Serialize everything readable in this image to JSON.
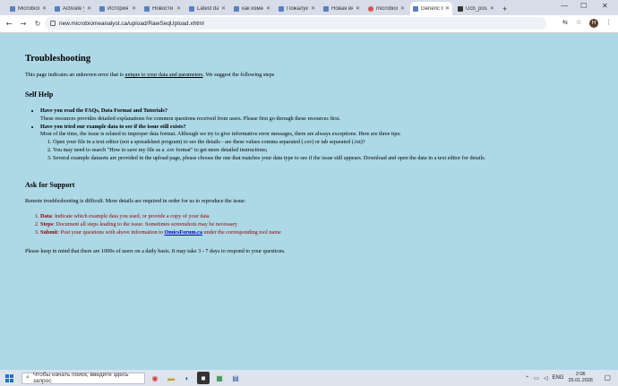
{
  "browser": {
    "tabs": [
      {
        "label": "Microbiom"
      },
      {
        "label": "Activate y"
      },
      {
        "label": "История"
      },
      {
        "label": "Новости"
      },
      {
        "label": "Latest data"
      },
      {
        "label": "как измени"
      },
      {
        "label": "Пожалуйс"
      },
      {
        "label": "Новая вкл"
      },
      {
        "label": "microbiom"
      },
      {
        "label": "Generic Er"
      },
      {
        "label": "Ucb_possib"
      }
    ],
    "new_tab": "+",
    "url": "new.microbiomeanalyst.ca/upload/RawSeqUpload.xhtml",
    "avatar_letter": "Н"
  },
  "page": {
    "title": "Troubleshooting",
    "intro_pre": "This page indicates an unknown error that is ",
    "intro_link": "unique to your data and parameters",
    "intro_post": ". We suggest the following steps",
    "self_help": {
      "heading": "Self Help",
      "faq_q": "Have you read the FAQs, Data Format and Tutorials?",
      "faq_a": "These resources provides detailed explanations for common questions received from users. Please first go through these resources first.",
      "example_q": "Have you tried our example data to see if the issue still exists?",
      "example_a": "Most of the time, the issue is related to improper data format. Although we try to give informative error messages, there are always exceptions. Here are three tips:",
      "tips": [
        "Open your file in a text editor (not a spreadsheet program) to see the details - are these values comma separated (.csv) or tab separated (.txt)?",
        "You may need to search \"How to save my file as a .csv format\" to get more detailed instructions;",
        "Several example datasets are provided in the upload page, please choose the one that matches your data type to see if the issue still appears. Download and open the data in a text editor for details."
      ]
    },
    "support": {
      "heading": "Ask for Support",
      "intro": "Remote troubleshooting is difficult. More details are required in order for us to reproduce the issue:",
      "items": [
        {
          "label": "Data",
          "text": ": Indicate which example data you used, or provide a copy of your data"
        },
        {
          "label": "Steps",
          "text": ": Document all steps leading to the issue. Sometimes screenshots may be necessary"
        },
        {
          "label": "Submit",
          "text_pre": ": Post your questions with above information to ",
          "link": "OmicsForum.ca",
          "text_post": " under the corresponding tool name"
        }
      ],
      "footer": "Please keep in mind that there are 1000s of users on a daily basis. It may take 3 - 7 days to respond to your questions."
    }
  },
  "taskbar": {
    "search_placeholder": "Чтобы начать поиск, введите здесь запрос",
    "lang": "ENG",
    "time": "2:06",
    "date": "25.01.2026"
  }
}
